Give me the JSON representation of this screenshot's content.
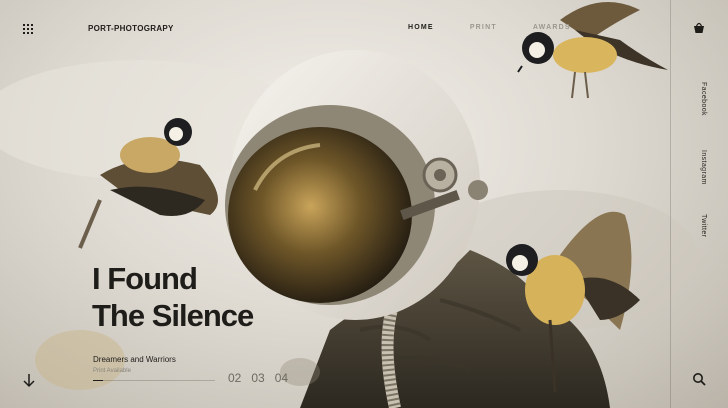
{
  "brand": "PORT-PHOTOGRAPY",
  "nav": {
    "home": "HOME",
    "print": "PRINT",
    "awards": "AWARDS"
  },
  "social": {
    "facebook": "Facebook",
    "instagram": "Instagram",
    "twitter": "Twitter"
  },
  "hero": {
    "title_line1": "I Found",
    "title_line2": "The Silence",
    "subtitle": "Dreamers and Warriors",
    "print_link": "Print Available",
    "progress": 0.08
  },
  "pager": [
    "02",
    "03",
    "04"
  ],
  "icons": {
    "menu": "grid-menu-icon",
    "scroll": "down-arrow-icon",
    "cart": "basket-icon",
    "search": "search-icon"
  },
  "colors": {
    "text": "#1f1d1a",
    "muted": "#9c978e",
    "background": "#d9d6cf"
  }
}
